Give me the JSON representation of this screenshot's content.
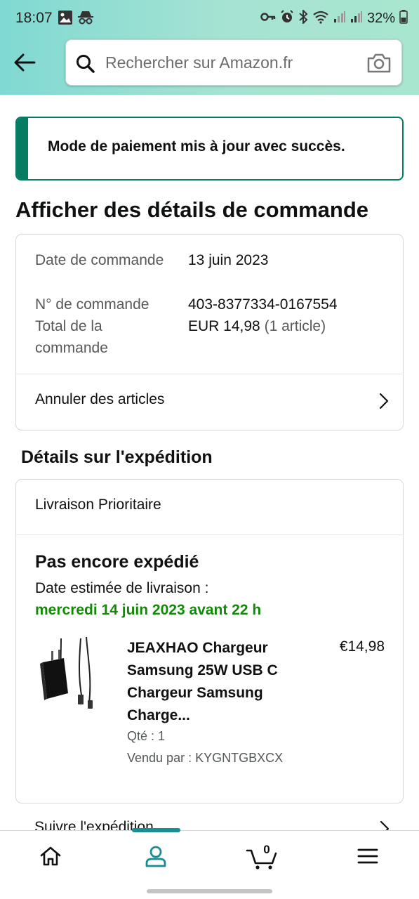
{
  "status_bar": {
    "time": "18:07",
    "battery_pct": "32%",
    "left_icons": [
      "gallery-icon",
      "incognito-icon"
    ],
    "right_icons": [
      "key-icon",
      "alarm-icon",
      "bluetooth-icon",
      "wifi-icon",
      "signal-icon",
      "signal-icon",
      "battery-icon"
    ]
  },
  "header": {
    "search_placeholder": "Rechercher sur Amazon.fr",
    "icons": [
      "back-arrow-icon",
      "search-icon",
      "camera-icon"
    ]
  },
  "alert": {
    "message": "Mode de paiement mis à jour avec succès."
  },
  "page_title": "Afficher des détails de commande",
  "order": {
    "date_label": "Date de commande",
    "date_value": "13 juin 2023",
    "number_label": "N° de commande",
    "number_value": "403-8377334-0167554",
    "total_label": "Total de la commande",
    "total_value": "EUR 14,98",
    "total_count": "(1 article)",
    "cancel_link": "Annuler des articles"
  },
  "shipping": {
    "section_title": "Détails sur l'expédition",
    "method": "Livraison Prioritaire",
    "status": "Pas encore expédié",
    "estimate_label": "Date estimée de livraison :",
    "estimate_date": "mercredi 14 juin 2023 avant 22 h",
    "track_link": "Suivre l'expédition"
  },
  "product": {
    "title": "JEAXHAO Chargeur Samsung 25W USB C Chargeur Samsung Charge...",
    "price": "€14,98",
    "qty": "Qté : 1",
    "seller": "Vendu par : KYGNTGBXCX"
  },
  "bottom_nav": {
    "items": [
      "home-icon",
      "account-icon",
      "cart-icon",
      "menu-icon"
    ],
    "active": "account-icon",
    "cart_count": "0"
  },
  "colors": {
    "header_gradient_start": "#80d9d3",
    "header_gradient_end": "#a9e6cf",
    "success_green": "#067d62",
    "delivery_green": "#138a07",
    "nav_accent": "#1a8c94",
    "text_primary": "#0f1111",
    "text_secondary": "#565959"
  }
}
